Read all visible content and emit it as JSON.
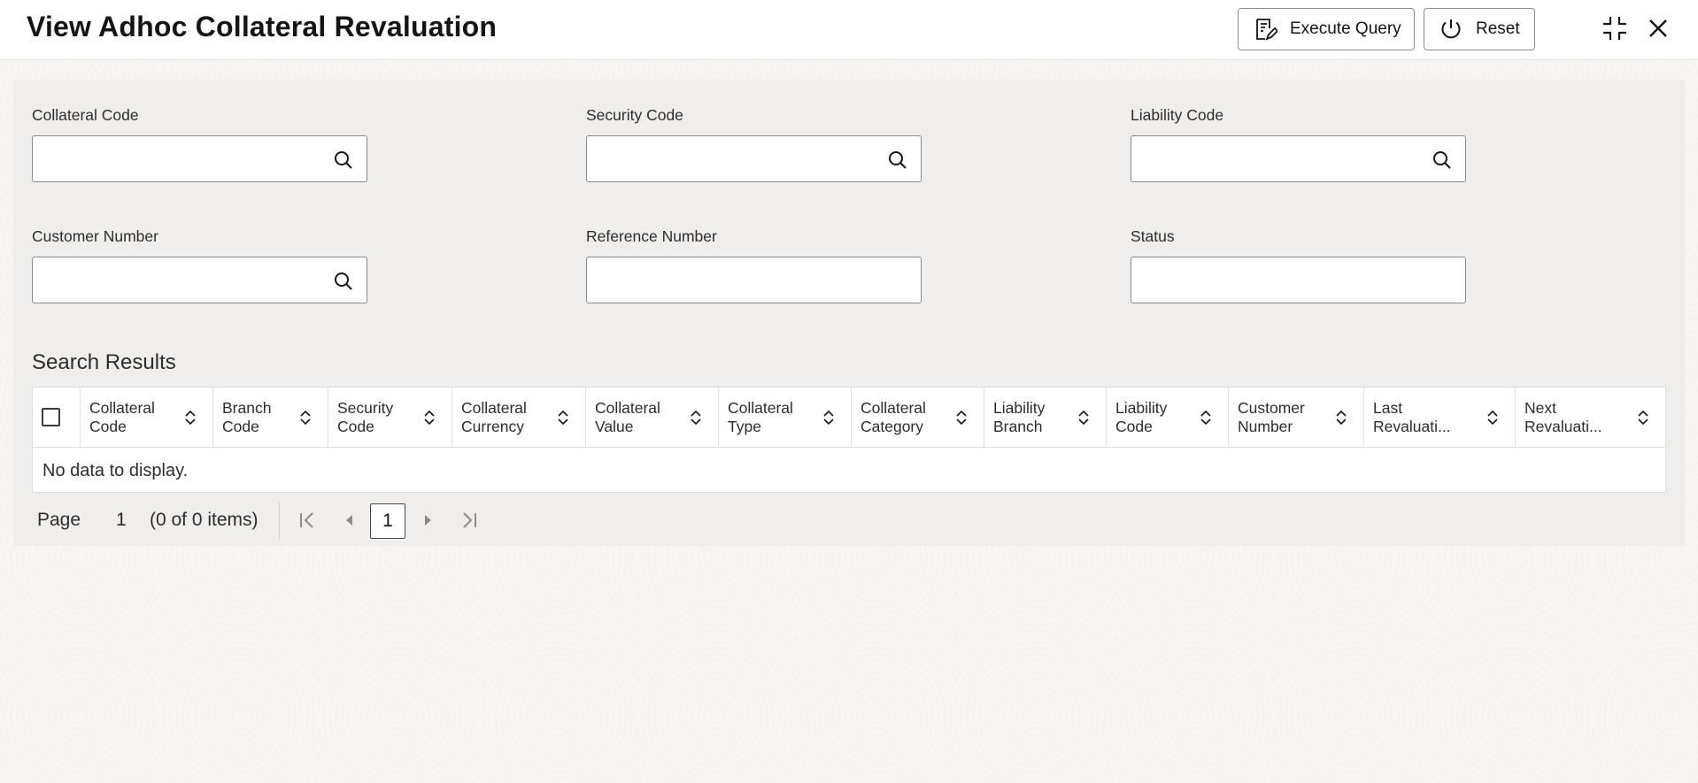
{
  "page": {
    "title": "View Adhoc Collateral Revaluation"
  },
  "toolbar": {
    "execute_query_label": "Execute Query",
    "reset_label": "Reset"
  },
  "form": {
    "collateral_code": {
      "label": "Collateral Code",
      "value": ""
    },
    "security_code": {
      "label": "Security Code",
      "value": ""
    },
    "liability_code": {
      "label": "Liability Code",
      "value": ""
    },
    "customer_number": {
      "label": "Customer Number",
      "value": ""
    },
    "reference_number": {
      "label": "Reference Number",
      "value": ""
    },
    "status": {
      "label": "Status",
      "value": ""
    }
  },
  "results": {
    "title": "Search Results",
    "columns": [
      "Collateral\nCode",
      "Branch\nCode",
      "Security\nCode",
      "Collateral\nCurrency",
      "Collateral\nValue",
      "Collateral\nType",
      "Collateral\nCategory",
      "Liability\nBranch",
      "Liability\nCode",
      "Customer\nNumber",
      "Last\nRevaluati...",
      "Next\nRevaluati..."
    ],
    "empty_message": "No data to display."
  },
  "pagination": {
    "page_label": "Page",
    "page_number": "1",
    "items_summary": "(0 of 0 items)",
    "current_page": "1"
  },
  "icons": {
    "execute_query": "execute-query-icon",
    "reset": "power-reset-icon",
    "minimize": "minimize-icon",
    "close": "close-icon",
    "search": "search-icon",
    "sort": "sort-icon"
  },
  "colors": {
    "panel": "#efeeec",
    "border": "#8d8984",
    "text": "#161513"
  }
}
